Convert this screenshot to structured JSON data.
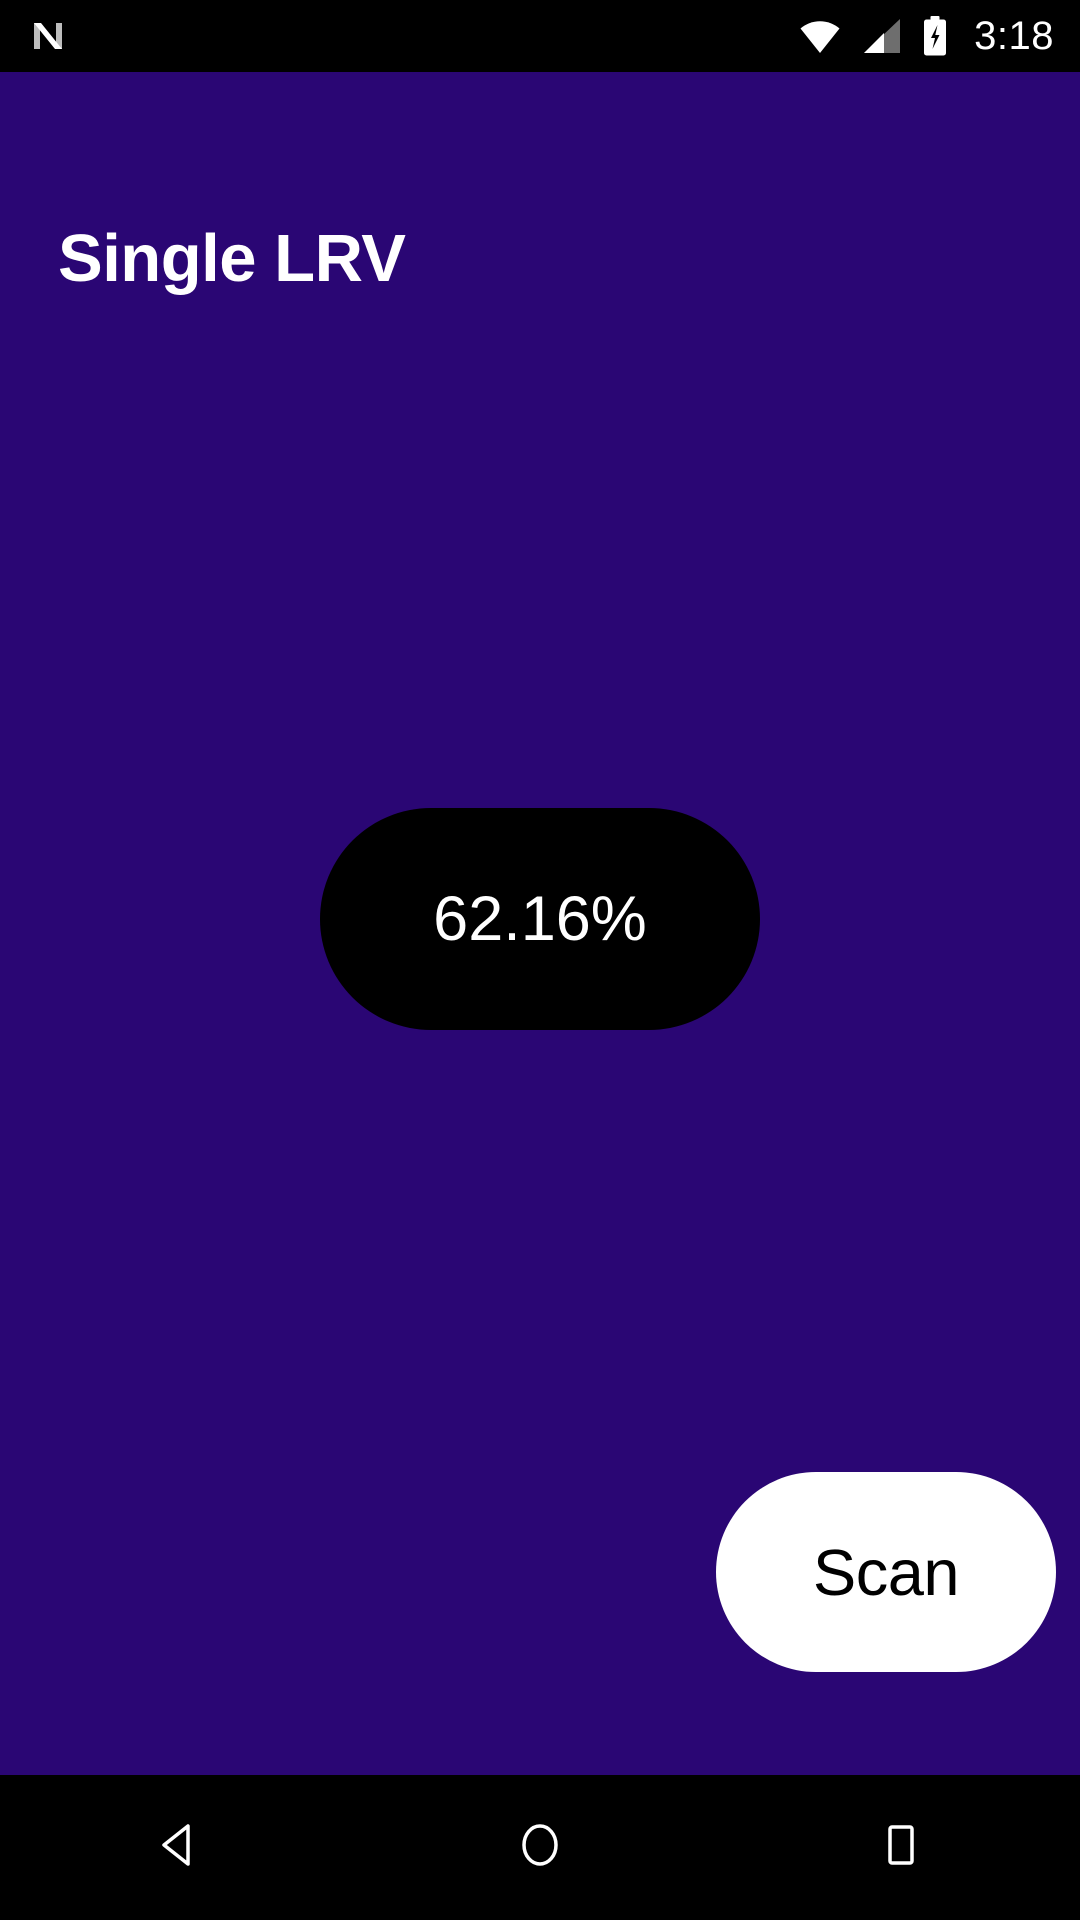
{
  "status_bar": {
    "notification_icon": "android-nougat-n-icon",
    "wifi_icon": "wifi-full-icon",
    "cellular_icon": "cellular-signal-icon",
    "battery_icon": "battery-charging-icon",
    "clock": "3:18",
    "background_color": "#000000",
    "foreground_color": "#FFFFFF"
  },
  "app": {
    "title": "Single LRV",
    "background_color": "#2A0674",
    "title_color": "#FFFFFF"
  },
  "value_display": {
    "value": "62.16%",
    "numeric_value": 62.16,
    "unit": "%",
    "background_color": "#000000",
    "text_color": "#FFFFFF"
  },
  "scan_button": {
    "label": "Scan",
    "background_color": "#FFFFFF",
    "text_color": "#000000"
  },
  "nav_bar": {
    "back_icon": "back-triangle-icon",
    "home_icon": "home-circle-icon",
    "recents_icon": "recents-square-icon",
    "background_color": "#000000",
    "icon_color": "#FFFFFF"
  }
}
